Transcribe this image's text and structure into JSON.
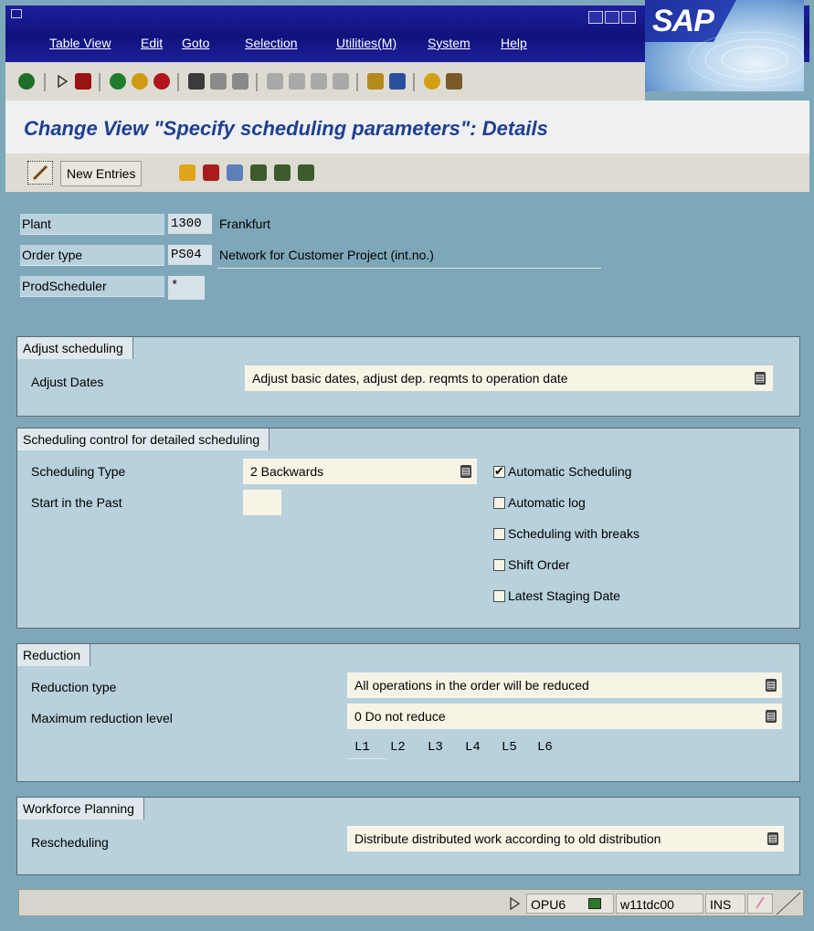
{
  "menubar": {
    "items": [
      "Table View",
      "Edit",
      "Goto",
      "Selection",
      "Utilities(M)",
      "System",
      "Help"
    ]
  },
  "brand": {
    "logo_text": "SAP"
  },
  "toolbar": {
    "icons": [
      "enter-icon",
      "back-arrow-icon",
      "save-icon",
      "back-icon",
      "exit-icon",
      "cancel-icon",
      "print-icon",
      "find-icon",
      "find-next-icon",
      "first-page-icon",
      "previous-page-icon",
      "next-page-icon",
      "last-page-icon",
      "create-session-icon",
      "shortcut-icon",
      "help-icon",
      "layout-icon"
    ]
  },
  "page": {
    "title": "Change View \"Specify scheduling parameters\": Details",
    "new_entries_label": "New Entries"
  },
  "header_fields": {
    "plant_label": "Plant",
    "plant_code": "1300",
    "plant_name": "Frankfurt",
    "order_type_label": "Order type",
    "order_type_code": "PS04",
    "order_type_name": "Network for Customer Project (int.no.)",
    "prod_scheduler_label": "ProdScheduler",
    "prod_scheduler_value": "*"
  },
  "adjust_scheduling": {
    "title": "Adjust scheduling",
    "adjust_dates_label": "Adjust Dates",
    "adjust_dates_value": "Adjust basic dates, adjust dep. reqmts to operation date"
  },
  "scheduling_control": {
    "title": "Scheduling control for detailed scheduling",
    "scheduling_type_label": "Scheduling Type",
    "scheduling_type_value": "2 Backwards",
    "start_in_past_label": "Start in the Past",
    "start_in_past_value": "",
    "checkboxes": [
      {
        "label": "Automatic Scheduling",
        "checked": true
      },
      {
        "label": "Automatic log",
        "checked": false
      },
      {
        "label": "Scheduling with breaks",
        "checked": false
      },
      {
        "label": "Shift Order",
        "checked": false
      },
      {
        "label": "Latest Staging Date",
        "checked": false
      }
    ]
  },
  "reduction": {
    "title": "Reduction",
    "type_label": "Reduction type",
    "type_value": "All operations in the order will be reduced",
    "max_level_label": "Maximum reduction level",
    "max_level_value": "0 Do not reduce",
    "levels": [
      "L1",
      "L2",
      "L3",
      "L4",
      "L5",
      "L6"
    ]
  },
  "workforce": {
    "title": "Workforce Planning",
    "rescheduling_label": "Rescheduling",
    "rescheduling_value": "Distribute distributed work according to old distribution"
  },
  "statusbar": {
    "transaction": "OPU6",
    "server": "w11tdc00",
    "mode": "INS"
  }
}
